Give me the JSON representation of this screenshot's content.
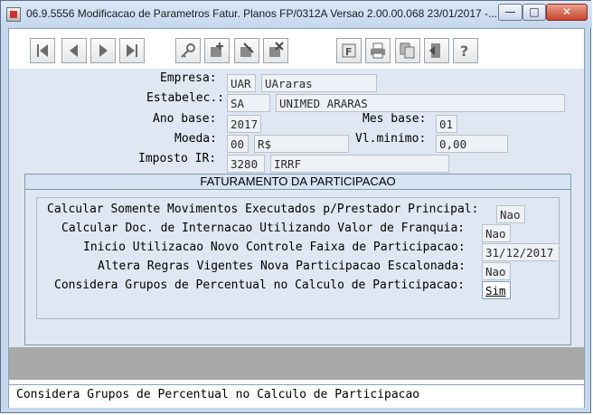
{
  "window": {
    "title": "06.9.5556 Modificacao  de Parametros Fatur. Planos FP/0312A Versao 2.00.00.068 23/01/2017 -..."
  },
  "toolbar": {
    "buttons": [
      "first",
      "previous",
      "next",
      "last",
      "search",
      "add",
      "edit",
      "delete",
      "filter",
      "print",
      "copy",
      "exit",
      "help"
    ]
  },
  "fields": {
    "empresa": {
      "label": "Empresa:",
      "code": "UAR",
      "name": "UAraras"
    },
    "estabelec": {
      "label": "Estabelec.:",
      "code": "SA",
      "name": "UNIMED ARARAS"
    },
    "ano_base": {
      "label": "Ano base:",
      "value": "2017"
    },
    "mes_base": {
      "label": "Mes base:",
      "value": "01"
    },
    "moeda": {
      "label": "Moeda:",
      "code": "00",
      "name": "R$"
    },
    "vl_minimo": {
      "label": "Vl.minimo:",
      "value": "0,00"
    },
    "imposto_ir": {
      "label": "Imposto IR:",
      "code": "3280",
      "name": "IRRF"
    }
  },
  "section": {
    "title": "FATURAMENTO DA PARTICIPACAO",
    "rows": [
      {
        "label": "Calcular Somente Movimentos Executados p/Prestador Principal:",
        "value": "Nao"
      },
      {
        "label": "Calcular Doc. de Internacao Utilizando Valor de Franquia:",
        "value": "Nao"
      },
      {
        "label": "Inicio Utilizacao Novo Controle Faixa de Participacao:",
        "value": "31/12/2017"
      },
      {
        "label": "Altera Regras Vigentes Nova Participacao Escalonada:",
        "value": "Nao"
      },
      {
        "label": "Considera Grupos de Percentual no Calculo de Participacao:",
        "value": "Sim"
      }
    ]
  },
  "statusbar": {
    "text": "Considera Grupos de Percentual no Calculo de Participacao"
  },
  "colors": {
    "window_frame": "#c5d8ee",
    "form_bg": "#dfe8f2",
    "field_bg": "#eef2f6",
    "greybar": "#a9a9a9"
  }
}
